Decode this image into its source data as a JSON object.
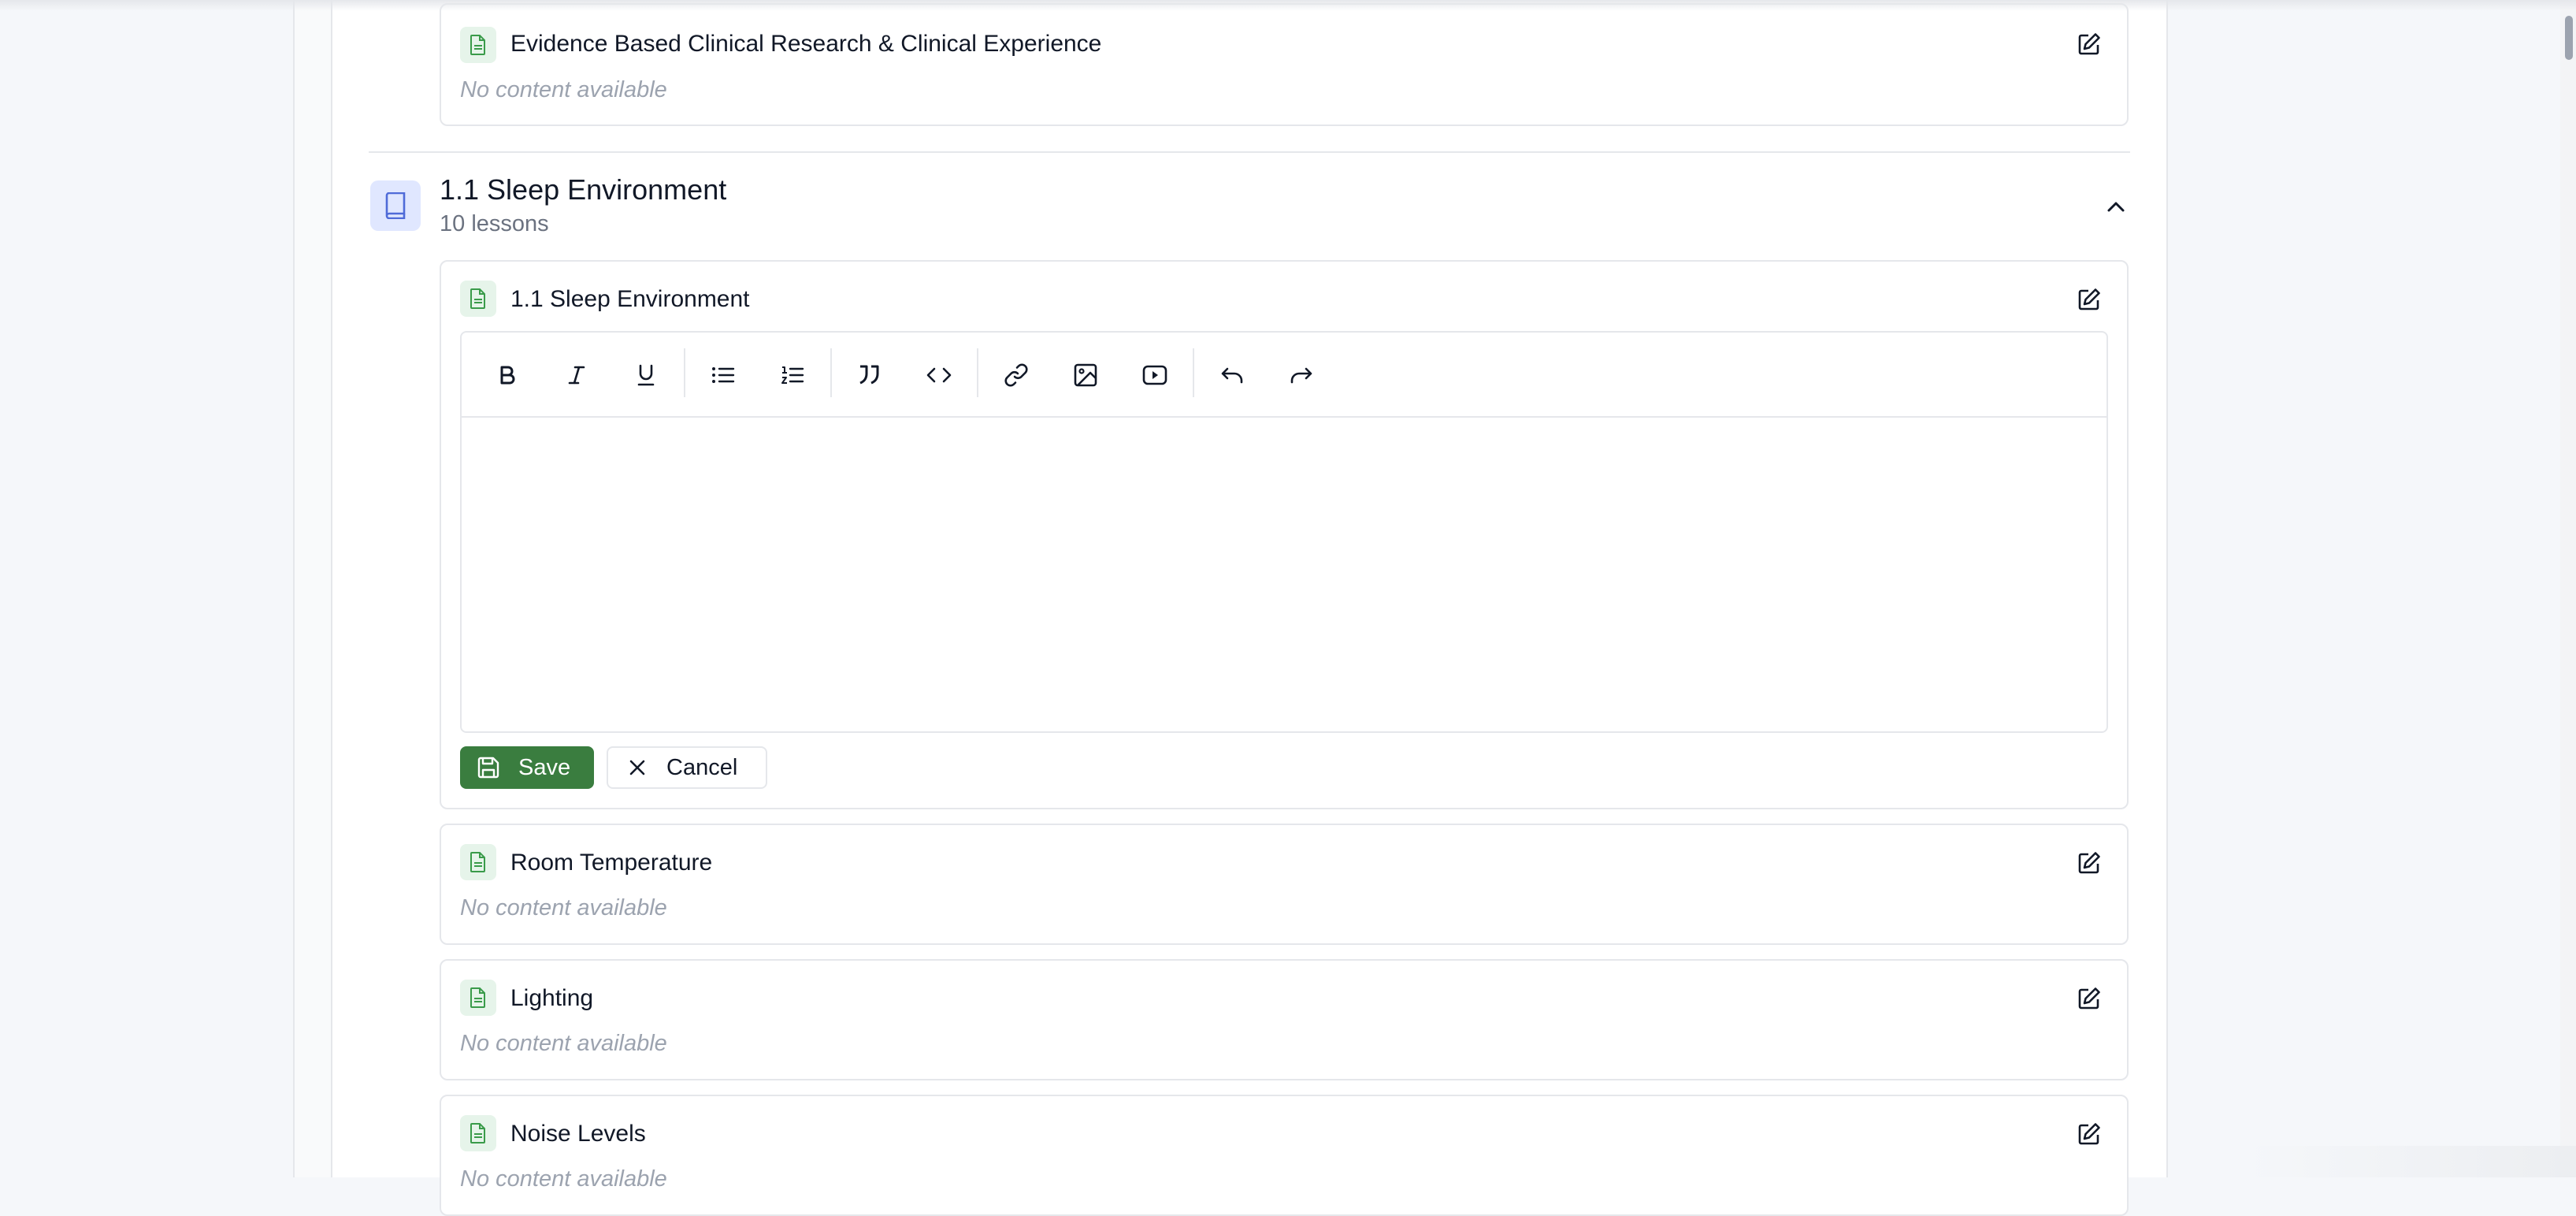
{
  "top_card": {
    "title": "Evidence Based Clinical Research & Clinical Experience",
    "empty_text": "No content available"
  },
  "module": {
    "title": "1.1 Sleep Environment",
    "subtitle": "10 lessons"
  },
  "editing_card": {
    "title": "1.1 Sleep Environment",
    "editor": {
      "toolbar": [
        "bold-icon",
        "italic-icon",
        "underline-icon",
        "bullet-list-icon",
        "ordered-list-icon",
        "quote-icon",
        "code-icon",
        "link-icon",
        "image-icon",
        "video-icon",
        "undo-icon",
        "redo-icon"
      ],
      "content": ""
    },
    "save_label": "Save",
    "cancel_label": "Cancel"
  },
  "lessons": [
    {
      "title": "Room Temperature",
      "empty_text": "No content available"
    },
    {
      "title": "Lighting",
      "empty_text": "No content available"
    },
    {
      "title": "Noise Levels",
      "empty_text": "No content available"
    }
  ],
  "colors": {
    "primary_green": "#3a7d3f",
    "icon_green_bg": "#e6f4ea",
    "module_icon_bg": "#e0e7ff",
    "muted_text": "#9ca3af"
  }
}
